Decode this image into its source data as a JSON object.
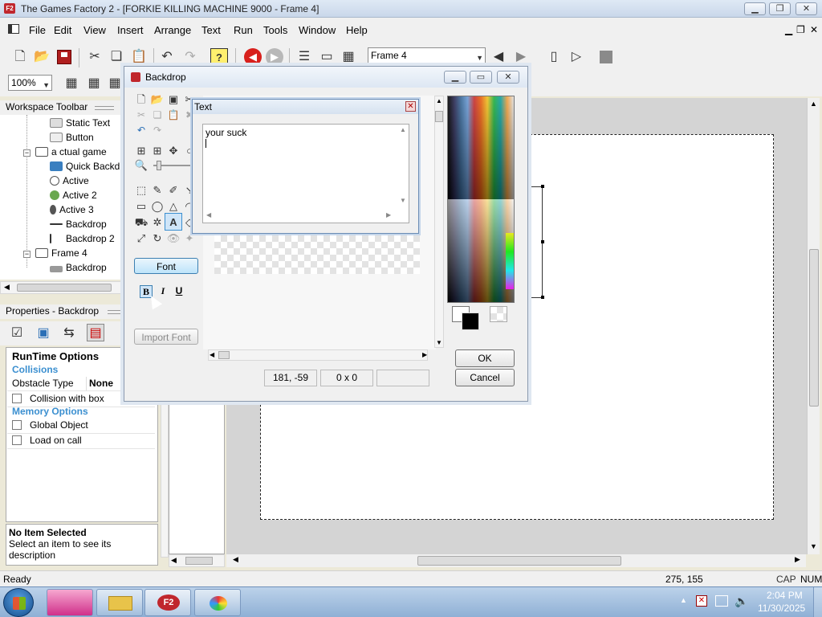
{
  "app": {
    "title": "The Games Factory 2 - [FORKIE KILLING MACHINE 9000 - Frame 4]"
  },
  "menu": [
    "File",
    "Edit",
    "View",
    "Insert",
    "Arrange",
    "Text",
    "Run",
    "Tools",
    "Window",
    "Help"
  ],
  "toolbar": {
    "frame_select": "Frame 4",
    "zoom": "100%"
  },
  "workspace": {
    "header": "Workspace Toolbar",
    "items": [
      {
        "label": "Static Text",
        "icon": "static-text-icon"
      },
      {
        "label": "Button",
        "icon": "button-icon"
      },
      {
        "label": "a ctual game",
        "icon": "frame-icon"
      },
      {
        "label": "Quick Backd",
        "icon": "quick-backdrop-icon"
      },
      {
        "label": "Active",
        "icon": "active-object-icon"
      },
      {
        "label": "Active 2",
        "icon": "active-object-icon"
      },
      {
        "label": "Active 3",
        "icon": "active-object-icon"
      },
      {
        "label": "Backdrop",
        "icon": "backdrop-line-icon"
      },
      {
        "label": "Backdrop 2",
        "icon": "backdrop-line-icon"
      },
      {
        "label": "Frame 4",
        "icon": "frame-icon"
      },
      {
        "label": "Backdrop",
        "icon": "backdrop-icon"
      }
    ]
  },
  "properties": {
    "header": "Properties - Backdrop",
    "title": "RunTime Options",
    "collisions": "Collisions",
    "obstacle_label": "Obstacle Type",
    "obstacle_value": "None",
    "collision_box": "Collision with box",
    "memory": "Memory Options",
    "global": "Global Object",
    "load_on_call": "Load on call",
    "desc_title": "No Item Selected",
    "desc_text": "Select an item to see its description"
  },
  "backdrop_dialog": {
    "title": "Backdrop",
    "font_button": "Font",
    "import_font": "Import Font",
    "coords": "181, -59",
    "size": "0 x 0",
    "ok": "OK",
    "cancel": "Cancel"
  },
  "text_dialog": {
    "title": "Text",
    "content": "your suck"
  },
  "status": {
    "left": "Ready",
    "coords": "275, 155",
    "cap": "CAP",
    "num": "NUM"
  },
  "clock": {
    "time": "2:04 PM",
    "date": "11/30/2025"
  },
  "colors": {
    "selected_fg": "#000000",
    "selected_bg": "#ffffff"
  }
}
